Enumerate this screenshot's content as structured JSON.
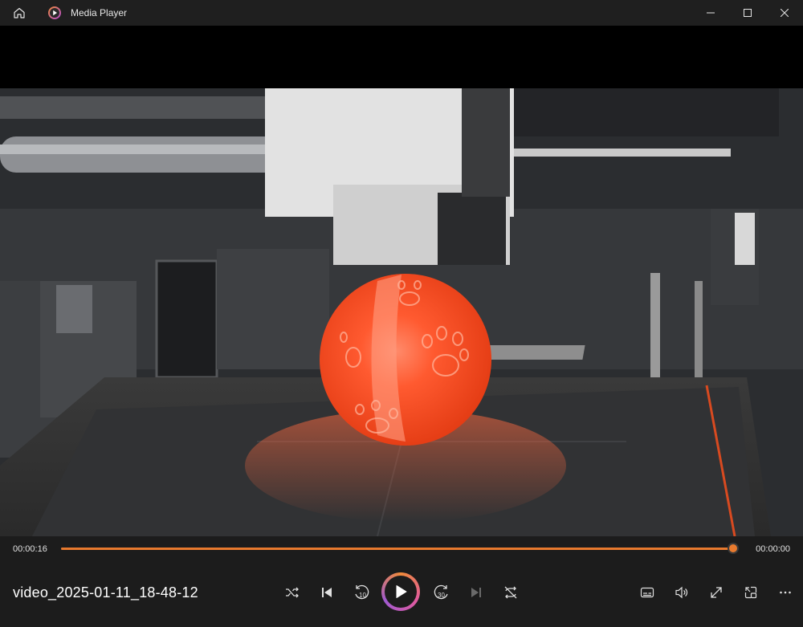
{
  "window": {
    "title": "Media Player"
  },
  "player": {
    "current_time": "00:00:16",
    "duration": "00:00:00",
    "progress": 0.999,
    "video_name": "video_2025-01-11_18-48-12",
    "skip_back_seconds": "10",
    "skip_forward_seconds": "30"
  },
  "colors": {
    "accent": "#e87a2e",
    "background": "#1c1c1c"
  },
  "icons": {
    "home": "home-icon",
    "app": "media-player-icon",
    "shuffle": "shuffle-icon",
    "previous": "previous-icon",
    "skip_back": "skip-back-10-icon",
    "play": "play-icon",
    "skip_forward": "skip-forward-30-icon",
    "next": "next-icon",
    "repeat": "repeat-icon",
    "subtitles": "subtitles-icon",
    "volume": "volume-icon",
    "fullscreen": "fullscreen-icon",
    "mini_player": "mini-player-icon",
    "more": "more-icon"
  }
}
